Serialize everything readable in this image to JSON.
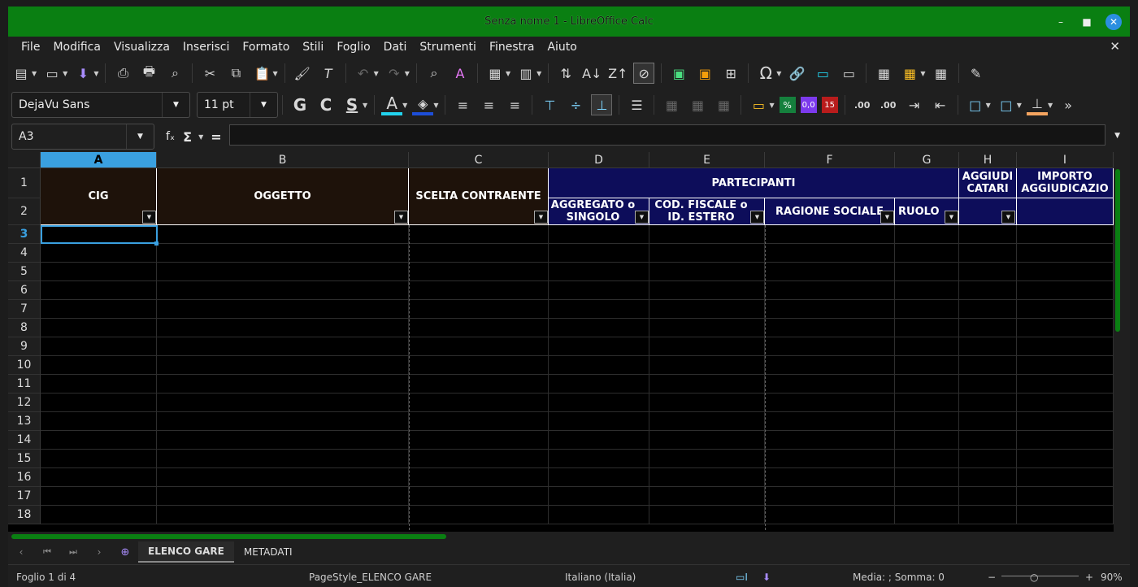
{
  "window": {
    "title": "Senza nome 1 - LibreOffice Calc"
  },
  "menu": [
    "File",
    "Modifica",
    "Visualizza",
    "Inserisci",
    "Formato",
    "Stili",
    "Foglio",
    "Dati",
    "Strumenti",
    "Finestra",
    "Aiuto"
  ],
  "font": {
    "name": "DejaVu Sans",
    "size": "11 pt"
  },
  "formatting": {
    "bold": "G",
    "italic": "C",
    "underline": "S",
    "font_color_label": "A"
  },
  "number_format_labels": {
    "percent": "%",
    "decimal": "0,0",
    "date": "15",
    "add_decimal": ".00",
    "del_decimal": ".00"
  },
  "namebox": "A3",
  "formula": {
    "fx": "fₓ",
    "sum": "Σ",
    "equals": "="
  },
  "columns": [
    "A",
    "B",
    "C",
    "D",
    "E",
    "F",
    "G",
    "H",
    "I"
  ],
  "rows": [
    "1",
    "2",
    "3",
    "4",
    "5",
    "6",
    "7",
    "8",
    "9",
    "10",
    "11",
    "12",
    "13",
    "14",
    "15",
    "16",
    "17",
    "18"
  ],
  "headers": {
    "cig": "CIG",
    "oggetto": "OGGETTO",
    "scelta": "SCELTA CONTRAENTE",
    "partecipanti": "PARTECIPANTI",
    "aggiudicatari": "AGGIUDI CATARI",
    "importo": "IMPORTO AGGIUDICAZIO",
    "aggregato": "AGGREGATO o SINGOLO",
    "codfiscale": "COD. FISCALE o ID. ESTERO",
    "ragione": "RAGIONE SOCIALE",
    "ruolo": "RUOLO"
  },
  "tabs": [
    "ELENCO GARE",
    "METADATI"
  ],
  "status": {
    "sheet": "Foglio 1 di 4",
    "pagestyle": "PageStyle_ELENCO GARE",
    "language": "Italiano (Italia)",
    "summary": "Media: ; Somma: 0",
    "zoom": "90%"
  },
  "colors": {
    "titlebar": "#0a7f12",
    "header_brown": "#1e120a",
    "header_navy": "#0d0d5a",
    "selection": "#3aa0e0"
  }
}
